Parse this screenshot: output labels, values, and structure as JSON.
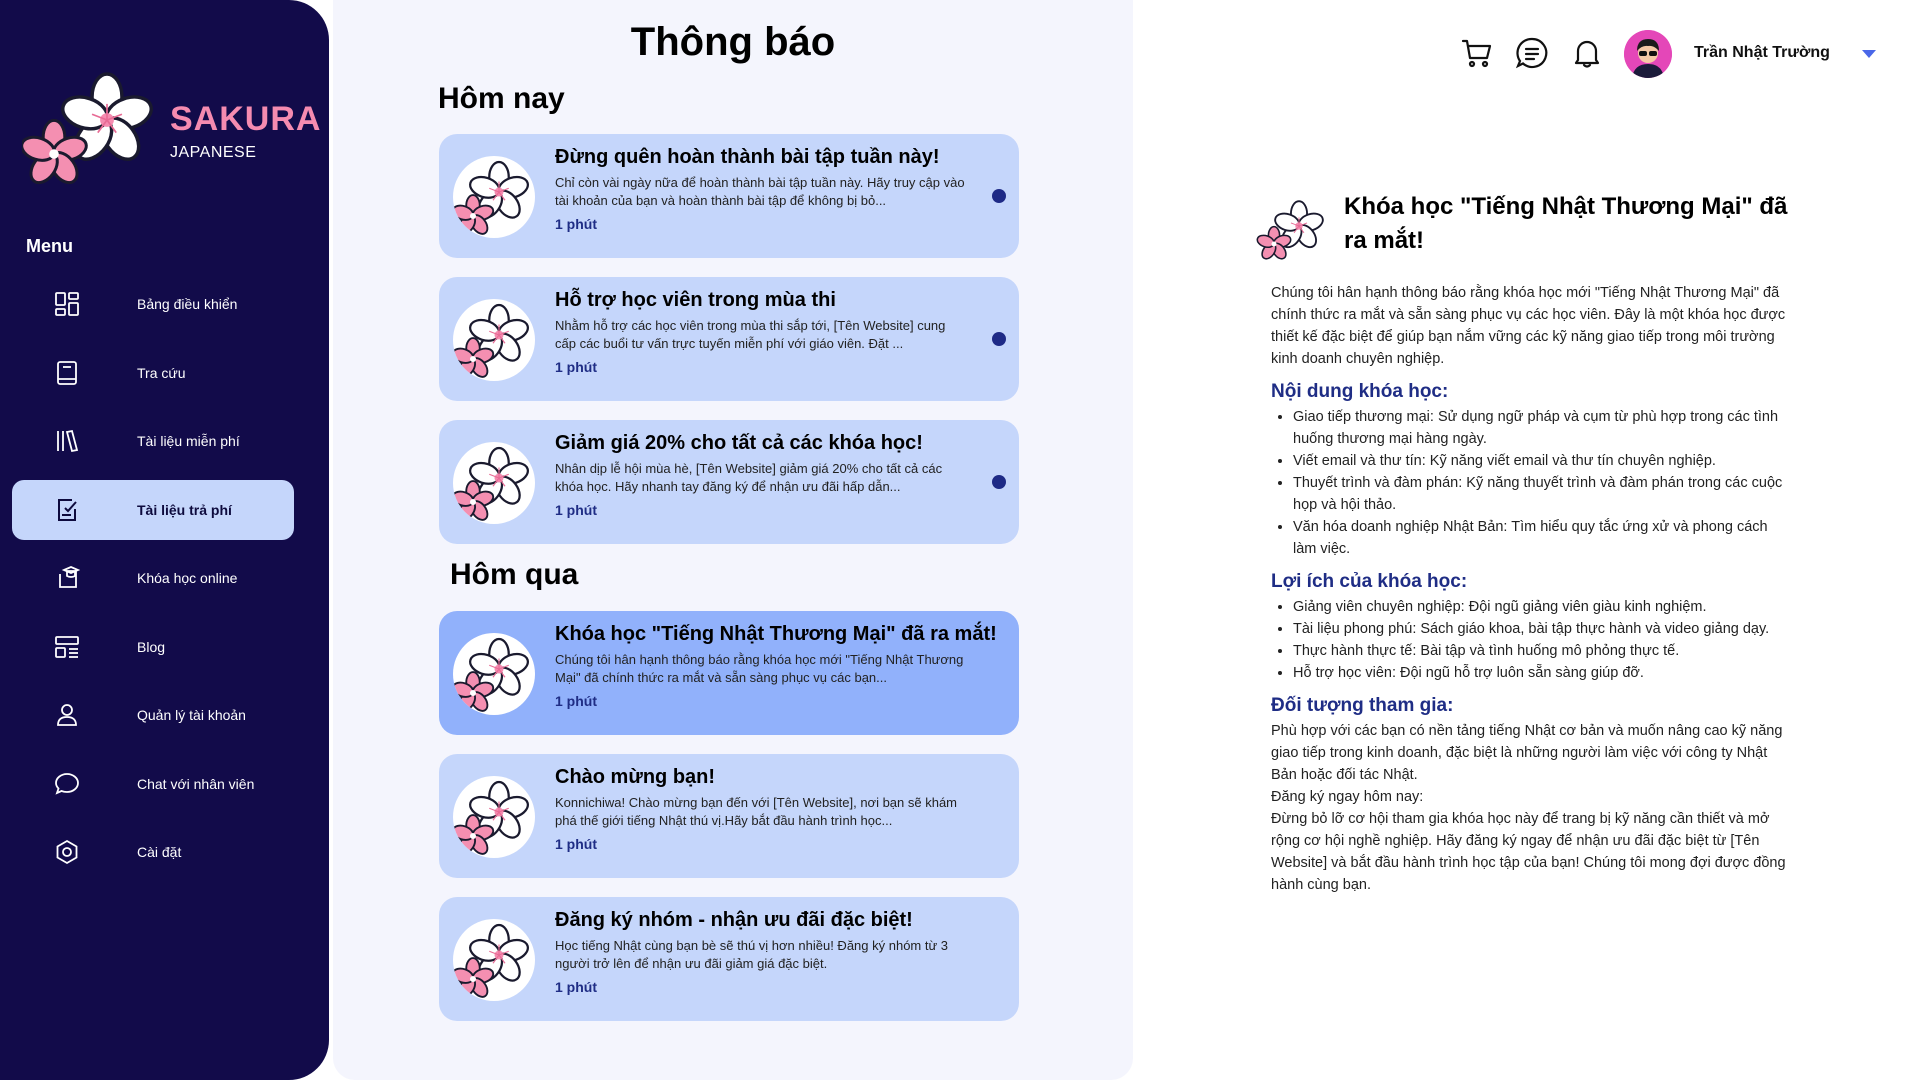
{
  "brand": {
    "name": "SAKURA",
    "subtitle": "JAPANESE"
  },
  "sidebar": {
    "menu_title": "Menu",
    "items": [
      {
        "label": "Bảng điều khiển",
        "icon": "dashboard-icon"
      },
      {
        "label": "Tra cứu",
        "icon": "book-icon"
      },
      {
        "label": "Tài liệu miễn phí",
        "icon": "library-icon"
      },
      {
        "label": "Tài liệu trả phí",
        "icon": "paid-doc-icon",
        "active": true
      },
      {
        "label": "Khóa học online",
        "icon": "graduation-cap-icon"
      },
      {
        "label": "Blog",
        "icon": "blog-icon"
      },
      {
        "label": "Quản lý tài khoản",
        "icon": "user-icon"
      },
      {
        "label": "Chat với nhân viên",
        "icon": "chat-icon"
      },
      {
        "label": "Cài đặt",
        "icon": "settings-icon"
      }
    ]
  },
  "notifications": {
    "title": "Thông báo",
    "today_label": "Hôm nay",
    "yesterday_label": "Hôm qua",
    "today": [
      {
        "title": "Đừng quên hoàn thành bài tập tuần này!",
        "body": "Chỉ còn vài ngày nữa để hoàn thành bài tập tuần này. Hãy truy cập vào tài khoản của bạn và hoàn thành bài tập để không bị bỏ...",
        "time": "1 phút",
        "unread": true
      },
      {
        "title": "Hỗ trợ học viên trong mùa thi",
        "body": "Nhằm hỗ trợ các học viên trong mùa thi sắp tới, [Tên Website] cung cấp các buổi tư vấn trực tuyến miễn phí với giáo viên. Đặt ...",
        "time": "1 phút",
        "unread": true
      },
      {
        "title": "Giảm giá 20% cho tất cả các khóa học!",
        "body": "Nhân dịp lễ hội mùa hè, [Tên Website] giảm giá 20% cho tất cả các khóa học. Hãy nhanh tay đăng ký để nhận ưu đãi hấp dẫn...",
        "time": "1 phút",
        "unread": true
      }
    ],
    "yesterday": [
      {
        "title": "Khóa học \"Tiếng Nhật Thương Mại\" đã ra mắt!",
        "body": "Chúng tôi hân hạnh thông báo rằng khóa học mới \"Tiếng Nhật Thương Mại\" đã chính thức ra mắt và sẵn sàng phục vụ các bạn...",
        "time": "1 phút",
        "selected": true
      },
      {
        "title": "Chào mừng bạn!",
        "body": "Konnichiwa! Chào mừng bạn đến với [Tên Website], nơi bạn sẽ khám phá thế giới tiếng Nhật thú vị.Hãy bắt đầu hành trình học...",
        "time": "1 phút"
      },
      {
        "title": " Đăng ký nhóm - nhận ưu đãi đặc biệt!",
        "body": "Học tiếng Nhật cùng bạn bè sẽ thú vị hơn nhiều! Đăng ký nhóm từ 3 người trở lên để nhận ưu đãi giảm giá đặc biệt.",
        "time": "1 phút"
      }
    ]
  },
  "header": {
    "user_name": "Trần Nhật Trường",
    "icons": [
      "cart-icon",
      "message-icon",
      "bell-icon"
    ]
  },
  "detail": {
    "title": "Khóa học \"Tiếng Nhật Thương Mại\" đã ra mắt!",
    "intro": "Chúng tôi hân hạnh thông báo rằng khóa học mới \"Tiếng Nhật Thương Mại\" đã chính thức ra mắt và sẵn sàng phục vụ các học viên. Đây là một khóa học được thiết kế đặc biệt để giúp bạn nắm vững các kỹ năng giao tiếp trong môi trường kinh doanh chuyên nghiệp.",
    "content_heading": "Nội dung khóa học:",
    "content_items": [
      "Giao tiếp thương mại: Sử dụng ngữ pháp và cụm từ phù hợp trong các tình huống thương mại hàng ngày.",
      "Viết email và thư tín: Kỹ năng viết email và thư tín chuyên nghiệp.",
      "Thuyết trình và đàm phán: Kỹ năng thuyết trình và đàm phán trong các cuộc họp và hội thảo.",
      "Văn hóa doanh nghiệp Nhật Bản: Tìm hiểu quy tắc ứng xử và phong cách làm việc."
    ],
    "benefits_heading": "Lợi ích của khóa học:",
    "benefit_items": [
      "Giảng viên chuyên nghiệp: Đội ngũ giảng viên giàu kinh nghiệm.",
      "Tài liệu phong phú: Sách giáo khoa, bài tập thực hành và video giảng dạy.",
      "Thực hành thực tế: Bài tập và tình huống mô phỏng thực tế.",
      "Hỗ trợ học viên: Đội ngũ hỗ trợ luôn sẵn sàng giúp đỡ."
    ],
    "audience_heading": "Đối tượng tham gia:",
    "audience_text": "Phù hợp với các bạn có nền tảng tiếng Nhật cơ bản và muốn nâng cao kỹ năng giao tiếp trong kinh doanh, đặc biệt là những người làm việc với công ty Nhật Bản hoặc đối tác Nhật.",
    "signup_label": "Đăng ký ngay hôm nay:",
    "closing_text": "Đừng bỏ lỡ cơ hội tham gia khóa học này để trang bị kỹ năng cần thiết và mở rộng cơ hội nghề nghiệp. Hãy đăng ký ngay để nhận ưu đãi đặc biệt từ [Tên Website] và bắt đầu hành trình học tập của bạn! Chúng tôi mong đợi được đồng hành cùng bạn."
  },
  "colors": {
    "sidebar_bg": "#120b4a",
    "brand_pink": "#f58bb0",
    "card_bg": "#c5d6fb",
    "card_selected": "#91b1fb",
    "accent_navy": "#1f2d85"
  }
}
